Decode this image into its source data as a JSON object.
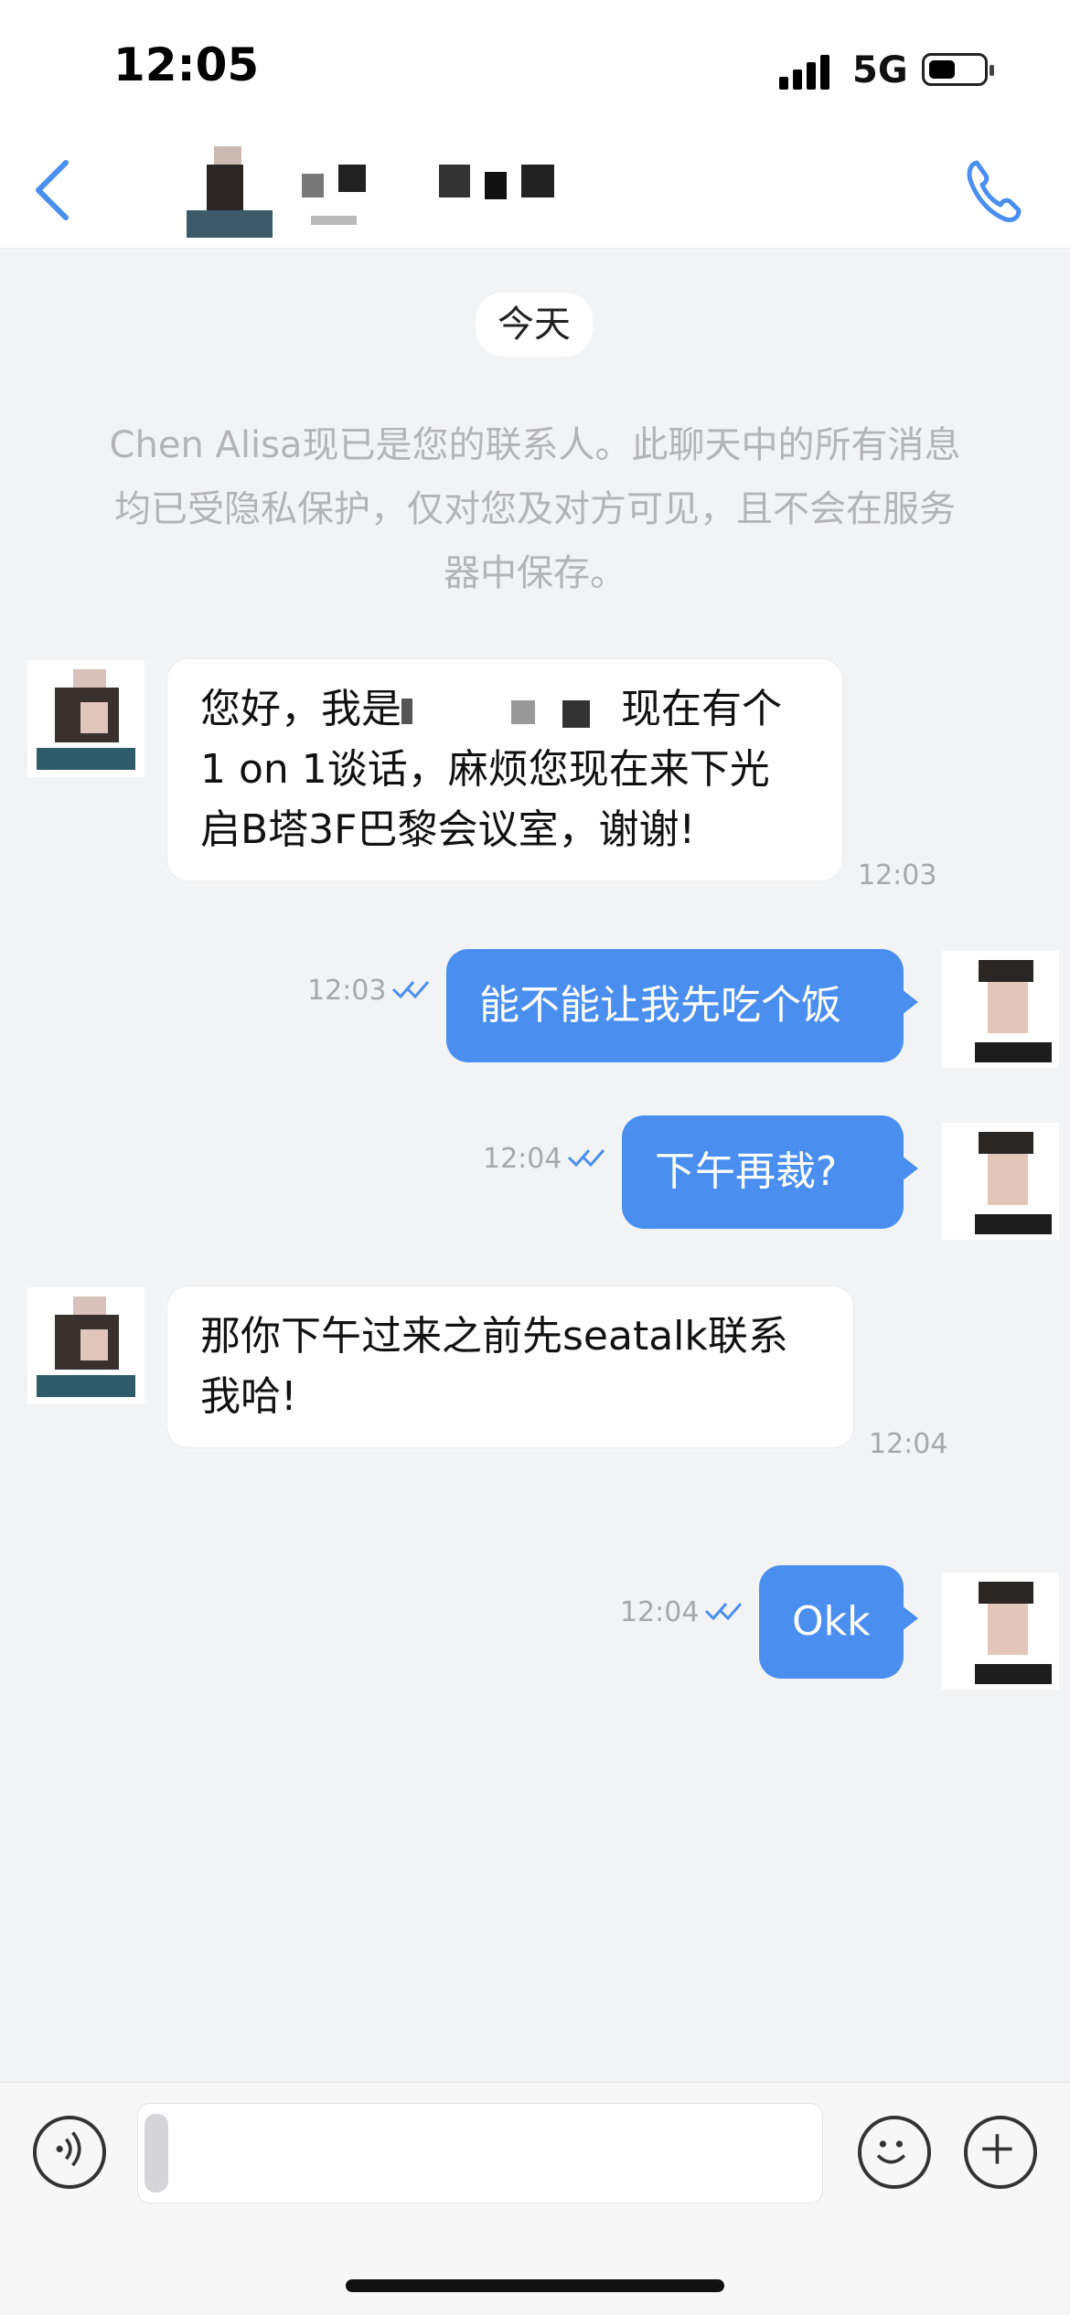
{
  "status_bar": {
    "time": "12:05",
    "network": "5G"
  },
  "header": {
    "icons": {
      "back": "chevron-left-icon",
      "call": "phone-icon"
    },
    "accent_color": "#4a8ff0"
  },
  "chat": {
    "date_label": "今天",
    "system_note": "Chen Alisa现已是您的联系人。此聊天中的所有消息均已受隐私保护，仅对您及对方可见，且不会在服务器中保存。",
    "messages": [
      {
        "direction": "incoming",
        "parts": [
          "您好，我是",
          "现在有个",
          "1 on 1谈话，麻烦您现在来下光",
          "启B塔3F巴黎会议室，谢谢!"
        ],
        "time": "12:03"
      },
      {
        "direction": "outgoing",
        "text": "能不能让我先吃个饭",
        "time": "12:03",
        "read": true
      },
      {
        "direction": "outgoing",
        "text": "下午再裁?",
        "time": "12:04",
        "read": true
      },
      {
        "direction": "incoming",
        "parts": [
          "那你下午过来之前先seatalk联系",
          "我哈!"
        ],
        "time": "12:04"
      },
      {
        "direction": "outgoing",
        "text": "Okk",
        "time": "12:04",
        "read": true
      }
    ]
  },
  "input_bar": {
    "placeholder": "",
    "icons": {
      "voice": "voice-icon",
      "emoji": "emoji-icon",
      "add": "plus-icon"
    }
  }
}
